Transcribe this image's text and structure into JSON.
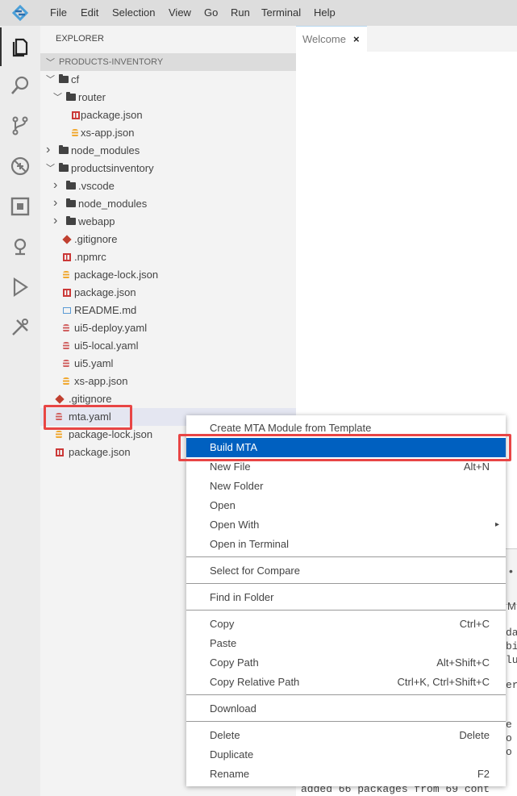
{
  "menubar": {
    "items": [
      "File",
      "Edit",
      "Selection",
      "View",
      "Go",
      "Run",
      "Terminal",
      "Help"
    ]
  },
  "explorer": {
    "title": "EXPLORER",
    "section": "PRODUCTS-INVENTORY",
    "tree": [
      {
        "label": "cf",
        "type": "folder",
        "open": true
      },
      {
        "label": "router",
        "type": "folder",
        "open": true
      },
      {
        "label": "package.json",
        "type": "npm"
      },
      {
        "label": "xs-app.json",
        "type": "json"
      },
      {
        "label": "node_modules",
        "type": "folder",
        "open": false
      },
      {
        "label": "productsinventory",
        "type": "folder",
        "open": true
      },
      {
        "label": ".vscode",
        "type": "folder",
        "open": false
      },
      {
        "label": "node_modules",
        "type": "folder",
        "open": false
      },
      {
        "label": "webapp",
        "type": "folder",
        "open": false
      },
      {
        "label": ".gitignore",
        "type": "git"
      },
      {
        "label": ".npmrc",
        "type": "npm"
      },
      {
        "label": "package-lock.json",
        "type": "json"
      },
      {
        "label": "package.json",
        "type": "npm"
      },
      {
        "label": "README.md",
        "type": "md"
      },
      {
        "label": "ui5-deploy.yaml",
        "type": "yaml"
      },
      {
        "label": "ui5-local.yaml",
        "type": "yaml"
      },
      {
        "label": "ui5.yaml",
        "type": "yaml"
      },
      {
        "label": "xs-app.json",
        "type": "json"
      },
      {
        "label": ".gitignore",
        "type": "git"
      },
      {
        "label": "mta.yaml",
        "type": "yaml",
        "selected": true
      },
      {
        "label": "package-lock.json",
        "type": "json"
      },
      {
        "label": "package.json",
        "type": "npm"
      }
    ]
  },
  "editor": {
    "tab": "Welcome",
    "tab_close": "×"
  },
  "context_menu": {
    "items": [
      {
        "label": "Create MTA Module from Template",
        "shortcut": ""
      },
      {
        "label": "Build MTA",
        "shortcut": "",
        "highlighted": true
      },
      {
        "label": "New File",
        "shortcut": "Alt+N"
      },
      {
        "label": "New Folder",
        "shortcut": ""
      },
      {
        "label": "Open",
        "shortcut": ""
      },
      {
        "label": "Open With",
        "shortcut": "▸"
      },
      {
        "label": "Open in Terminal",
        "shortcut": ""
      },
      {
        "label": "Select for Compare",
        "shortcut": ""
      },
      {
        "label": "Find in Folder",
        "shortcut": ""
      },
      {
        "label": "Copy",
        "shortcut": "Ctrl+C"
      },
      {
        "label": "Paste",
        "shortcut": ""
      },
      {
        "label": "Copy Path",
        "shortcut": "Alt+Shift+C"
      },
      {
        "label": "Copy Relative Path",
        "shortcut": "Ctrl+K, Ctrl+Shift+C"
      },
      {
        "label": "Download",
        "shortcut": ""
      },
      {
        "label": "Delete",
        "shortcut": "Delete"
      },
      {
        "label": "Duplicate",
        "shortcut": ""
      },
      {
        "label": "Rename",
        "shortcut": "F2"
      }
    ]
  },
  "terminal": {
    "fragments": [
      "M",
      "da",
      "bi",
      "lu",
      "er",
      "e",
      "o",
      "o"
    ],
    "last_line": "added 66 packages from 69 cont"
  },
  "colors": {
    "highlight": "#0060c0",
    "annotation": "#e84545",
    "npm": "#cb3837",
    "json": "#f0a830",
    "yaml": "#d06060"
  }
}
